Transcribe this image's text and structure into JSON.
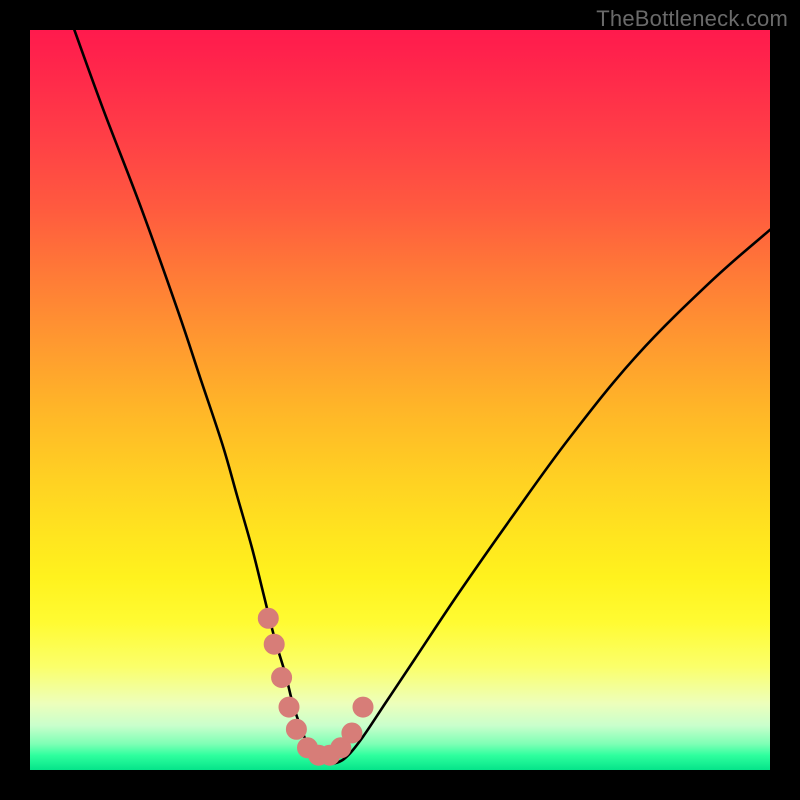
{
  "watermark": "TheBottleneck.com",
  "chart_data": {
    "type": "line",
    "title": "",
    "xlabel": "",
    "ylabel": "",
    "xlim": [
      0,
      100
    ],
    "ylim": [
      0,
      100
    ],
    "series": [
      {
        "name": "bottleneck-curve",
        "x": [
          6,
          10,
          15,
          20,
          23,
          26,
          28,
          30,
          31.5,
          33,
          34.5,
          35.5,
          36.5,
          37.5,
          38.5,
          40,
          41.5,
          43,
          45,
          48,
          52,
          58,
          65,
          73,
          82,
          92,
          100
        ],
        "y": [
          100,
          89,
          76,
          62,
          53,
          44,
          37,
          30,
          24,
          18,
          13,
          9,
          6,
          3.5,
          2,
          1,
          1,
          2,
          4.5,
          9,
          15,
          24,
          34,
          45,
          56,
          66,
          73
        ]
      }
    ],
    "markers": {
      "name": "curve-dots",
      "x": [
        32.2,
        33.0,
        34.0,
        35.0,
        36.0,
        37.5,
        39.0,
        40.5,
        42.0,
        43.5,
        45.0
      ],
      "y": [
        20.5,
        17.0,
        12.5,
        8.5,
        5.5,
        3.0,
        2.0,
        2.0,
        3.0,
        5.0,
        8.5
      ]
    },
    "colors": {
      "curve": "#000000",
      "markers": "#d77d78",
      "gradient_top": "#ff1a4d",
      "gradient_bottom": "#05e48a"
    }
  }
}
